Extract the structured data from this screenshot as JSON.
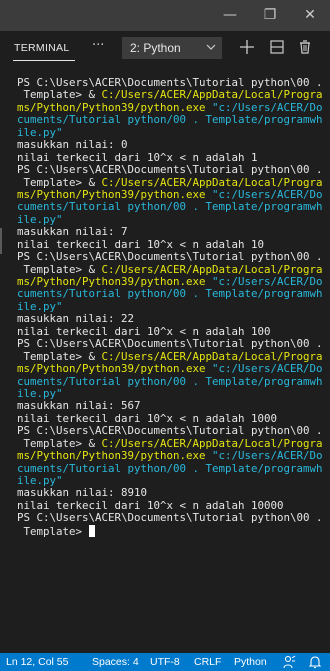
{
  "window": {
    "minimize_glyph": "—",
    "maximize_glyph": "❐",
    "close_glyph": "✕"
  },
  "panel": {
    "tab_label": "TERMINAL",
    "more_glyph": "···",
    "terminal_select_value": "2: Python",
    "icons": [
      "chevron-down-icon",
      "plus-icon",
      "split-icon",
      "trash-icon"
    ]
  },
  "terminal": {
    "lines": [
      [
        {
          "t": "PS C:\\Users\\ACER\\Documents\\Tutorial python\\00 .",
          "c": "w"
        }
      ],
      [
        {
          "t": " Template> & ",
          "c": "w"
        },
        {
          "t": "C:/Users/ACER/AppData/Local/Progra",
          "c": "y"
        }
      ],
      [
        {
          "t": "ms/Python/Python39/python.exe ",
          "c": "y"
        },
        {
          "t": "\"c:/Users/ACER/Do",
          "c": "c"
        }
      ],
      [
        {
          "t": "cuments/Tutorial python/00 . Template/programwh",
          "c": "c"
        }
      ],
      [
        {
          "t": "ile.py\"",
          "c": "c"
        }
      ],
      [
        {
          "t": "masukkan nilai: 0",
          "c": "w"
        }
      ],
      [
        {
          "t": "nilai terkecil dari 10^x < n adalah 1",
          "c": "w"
        }
      ],
      [
        {
          "t": "PS C:\\Users\\ACER\\Documents\\Tutorial python\\00 .",
          "c": "w"
        }
      ],
      [
        {
          "t": " Template> & ",
          "c": "w"
        },
        {
          "t": "C:/Users/ACER/AppData/Local/Progra",
          "c": "y"
        }
      ],
      [
        {
          "t": "ms/Python/Python39/python.exe ",
          "c": "y"
        },
        {
          "t": "\"c:/Users/ACER/Do",
          "c": "c"
        }
      ],
      [
        {
          "t": "cuments/Tutorial python/00 . Template/programwh",
          "c": "c"
        }
      ],
      [
        {
          "t": "ile.py\"",
          "c": "c"
        }
      ],
      [
        {
          "t": "masukkan nilai: 7",
          "c": "w"
        }
      ],
      [
        {
          "t": "nilai terkecil dari 10^x < n adalah 10",
          "c": "w"
        }
      ],
      [
        {
          "t": "PS C:\\Users\\ACER\\Documents\\Tutorial python\\00 .",
          "c": "w"
        }
      ],
      [
        {
          "t": " Template> & ",
          "c": "w"
        },
        {
          "t": "C:/Users/ACER/AppData/Local/Progra",
          "c": "y"
        }
      ],
      [
        {
          "t": "ms/Python/Python39/python.exe ",
          "c": "y"
        },
        {
          "t": "\"c:/Users/ACER/Do",
          "c": "c"
        }
      ],
      [
        {
          "t": "cuments/Tutorial python/00 . Template/programwh",
          "c": "c"
        }
      ],
      [
        {
          "t": "ile.py\"",
          "c": "c"
        }
      ],
      [
        {
          "t": "masukkan nilai: 22",
          "c": "w"
        }
      ],
      [
        {
          "t": "nilai terkecil dari 10^x < n adalah 100",
          "c": "w"
        }
      ],
      [
        {
          "t": "PS C:\\Users\\ACER\\Documents\\Tutorial python\\00 .",
          "c": "w"
        }
      ],
      [
        {
          "t": " Template> & ",
          "c": "w"
        },
        {
          "t": "C:/Users/ACER/AppData/Local/Progra",
          "c": "y"
        }
      ],
      [
        {
          "t": "ms/Python/Python39/python.exe ",
          "c": "y"
        },
        {
          "t": "\"c:/Users/ACER/Do",
          "c": "c"
        }
      ],
      [
        {
          "t": "cuments/Tutorial python/00 . Template/programwh",
          "c": "c"
        }
      ],
      [
        {
          "t": "ile.py\"",
          "c": "c"
        }
      ],
      [
        {
          "t": "masukkan nilai: 567",
          "c": "w"
        }
      ],
      [
        {
          "t": "nilai terkecil dari 10^x < n adalah 1000",
          "c": "w"
        }
      ],
      [
        {
          "t": "PS C:\\Users\\ACER\\Documents\\Tutorial python\\00 .",
          "c": "w"
        }
      ],
      [
        {
          "t": " Template> & ",
          "c": "w"
        },
        {
          "t": "C:/Users/ACER/AppData/Local/Progra",
          "c": "y"
        }
      ],
      [
        {
          "t": "ms/Python/Python39/python.exe ",
          "c": "y"
        },
        {
          "t": "\"c:/Users/ACER/Do",
          "c": "c"
        }
      ],
      [
        {
          "t": "cuments/Tutorial python/00 . Template/programwh",
          "c": "c"
        }
      ],
      [
        {
          "t": "ile.py\"",
          "c": "c"
        }
      ],
      [
        {
          "t": "masukkan nilai: 8910",
          "c": "w"
        }
      ],
      [
        {
          "t": "nilai terkecil dari 10^x < n adalah 10000",
          "c": "w"
        }
      ],
      [
        {
          "t": "PS C:\\Users\\ACER\\Documents\\Tutorial python\\00 .",
          "c": "w"
        }
      ],
      [
        {
          "t": " Template> ",
          "c": "w"
        }
      ]
    ]
  },
  "statusbar": {
    "position": "Ln 12, Col 55",
    "spaces": "Spaces: 4",
    "encoding": "UTF-8",
    "eol": "CRLF",
    "language": "Python"
  },
  "colors": {
    "yellow": "#e5e510",
    "cyan": "#29b8db",
    "status_bg": "#007acc"
  }
}
